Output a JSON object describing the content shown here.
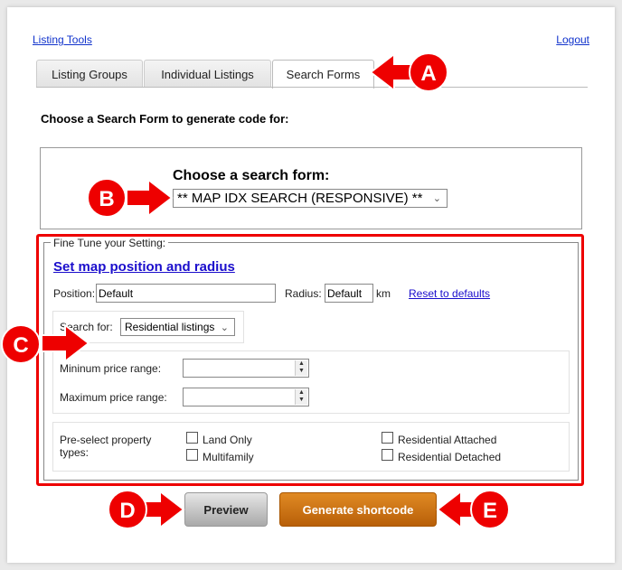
{
  "header": {
    "listing_tools": "Listing Tools",
    "logout": "Logout"
  },
  "tabs": [
    {
      "label": "Listing Groups"
    },
    {
      "label": "Individual Listings"
    },
    {
      "label": "Search Forms",
      "active": true
    }
  ],
  "heading": "Choose a Search Form to generate code for:",
  "form_chooser": {
    "label": "Choose a search form:",
    "selected": "** MAP IDX SEARCH (RESPONSIVE) **"
  },
  "fine_tune": {
    "legend": "Fine Tune your Setting:",
    "map_link": "Set map position and radius",
    "position_label": "Position:",
    "position_value": "Default",
    "radius_label": "Radius:",
    "radius_value": "Default",
    "radius_unit": "km",
    "reset_link": "Reset to defaults",
    "search_for_label": "Search for:",
    "search_for_selected": "Residential listings",
    "min_price_label": "Mininum price range:",
    "max_price_label": "Maximum price range:",
    "min_price_value": "",
    "max_price_value": "",
    "property_types_label": "Pre-select property types:",
    "property_types": [
      {
        "label": "Land Only",
        "checked": false
      },
      {
        "label": "Multifamily",
        "checked": false
      },
      {
        "label": "Residential Attached",
        "checked": false
      },
      {
        "label": "Residential Detached",
        "checked": false
      }
    ]
  },
  "buttons": {
    "preview": "Preview",
    "generate": "Generate shortcode"
  },
  "annotations": [
    {
      "letter": "A"
    },
    {
      "letter": "B"
    },
    {
      "letter": "C"
    },
    {
      "letter": "D"
    },
    {
      "letter": "E"
    }
  ],
  "colors": {
    "annotation_red": "#ee0000",
    "generate_orange": "#c8700e",
    "link_blue": "#1a0dab"
  }
}
